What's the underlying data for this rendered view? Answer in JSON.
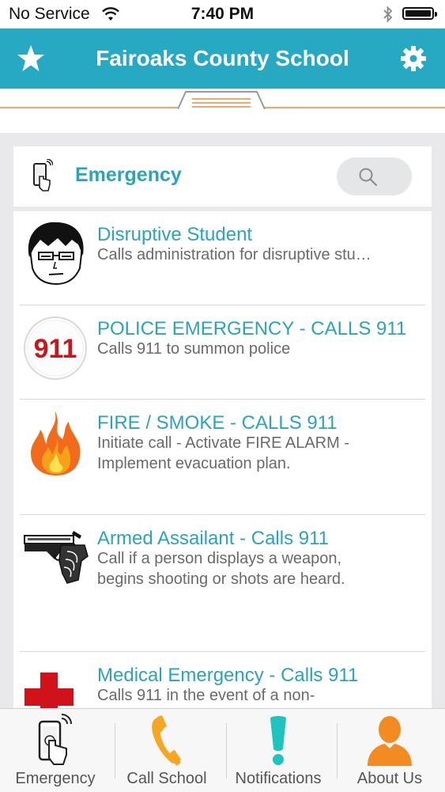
{
  "status_bar": {
    "carrier": "No Service",
    "time": "7:40 PM"
  },
  "nav": {
    "title": "Fairoaks County School",
    "left_icon": "star-icon",
    "right_icon": "gear-icon",
    "accent": "#27a8c3"
  },
  "section": {
    "title": "Emergency",
    "icon": "touch-phone-icon"
  },
  "items": [
    {
      "title": "Disruptive Student",
      "desc": "Calls administration for disruptive stu…",
      "icon": "student-face-icon"
    },
    {
      "title": "POLICE EMERGENCY - CALLS 911",
      "desc": "Calls 911 to summon police",
      "icon": "911-badge-icon",
      "badge": "911"
    },
    {
      "title": "FIRE / SMOKE - CALLS 911",
      "desc": "Initiate call - Activate FIRE ALARM -\nImplement evacuation plan.",
      "icon": "fire-icon"
    },
    {
      "title": "Armed Assailant - Calls 911",
      "desc": "Call if a person displays a weapon,\nbegins shooting or shots are heard.",
      "icon": "handgun-icon"
    },
    {
      "title": "Medical Emergency - Calls 911",
      "desc": "Calls 911 in the event of a non-",
      "icon": "red-cross-icon"
    }
  ],
  "tabs": [
    {
      "label": "Emergency",
      "icon": "touch-phone-icon"
    },
    {
      "label": "Call School",
      "icon": "phone-handset-icon"
    },
    {
      "label": "Notifications",
      "icon": "exclamation-icon"
    },
    {
      "label": "About Us",
      "icon": "person-icon"
    }
  ]
}
